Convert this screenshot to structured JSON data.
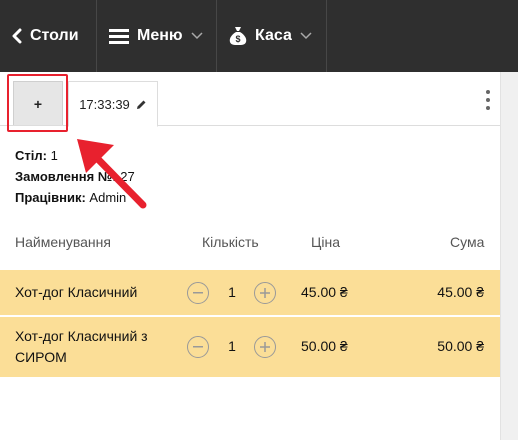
{
  "topbar": {
    "back_label": "Столи",
    "menu_label": "Меню",
    "cash_label": "Каса"
  },
  "tabs": {
    "add_label": "+",
    "time_label": "17:33:39"
  },
  "order_info": {
    "table_label": "Стіл:",
    "table_value": "1",
    "order_label": "Замовлення №:",
    "order_value": "27",
    "worker_label": "Працівник:",
    "worker_value": "Admin"
  },
  "table": {
    "headers": {
      "name": "Найменування",
      "qty": "Кількість",
      "price": "Ціна",
      "sum": "Сума"
    },
    "rows": [
      {
        "name": "Хот-дог Класичний",
        "qty": "1",
        "price": "45.00 ₴",
        "sum": "45.00 ₴"
      },
      {
        "name": "Хот-дог Класичний з СИРОМ",
        "qty": "1",
        "price": "50.00 ₴",
        "sum": "50.00 ₴"
      }
    ]
  },
  "colors": {
    "topbar": "#2f2f2f",
    "row_highlight": "#fbde97",
    "annotation": "#e8212e"
  },
  "icons": [
    "chevron-left-icon",
    "hamburger-icon",
    "money-bag-icon",
    "chevron-down-icon",
    "pencil-icon",
    "kebab-icon",
    "minus-circle-icon",
    "plus-circle-icon"
  ]
}
